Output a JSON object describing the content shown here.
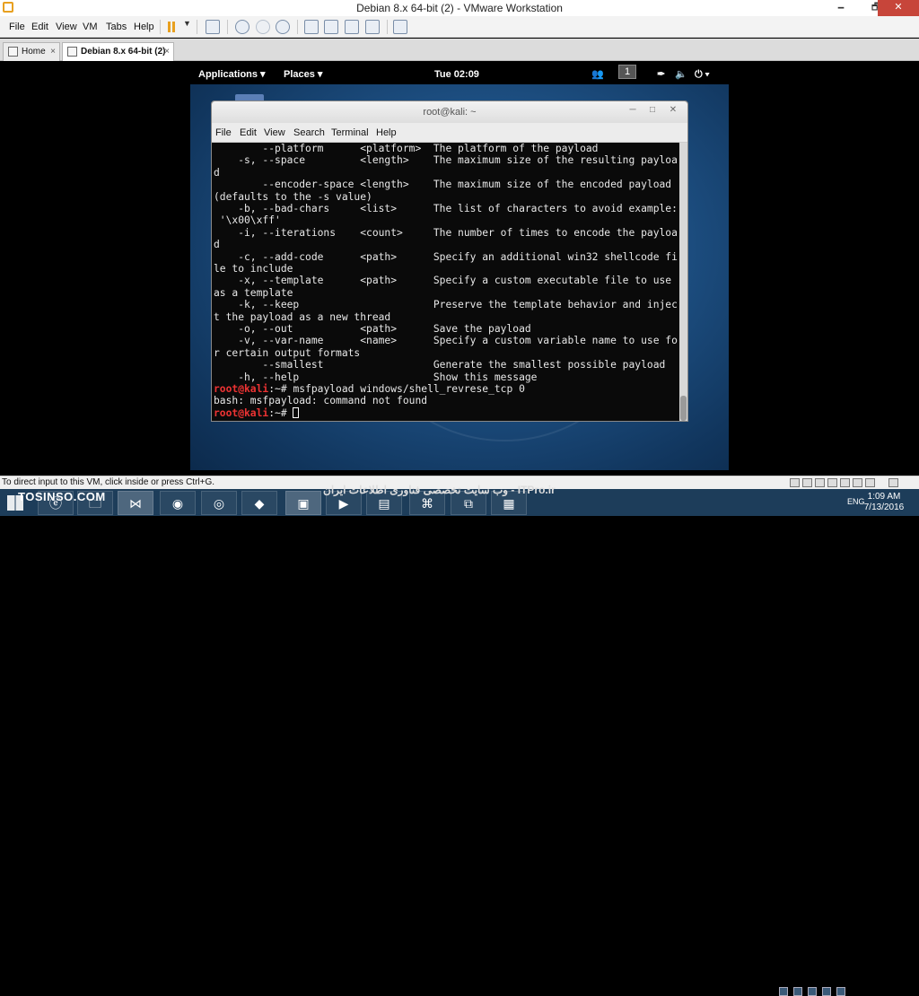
{
  "window": {
    "title": "Debian 8.x 64-bit (2) - VMware Workstation",
    "minimize": "🗕",
    "maximize": "🗗",
    "close": "✕"
  },
  "menu": [
    "File",
    "Edit",
    "View",
    "VM",
    "Tabs",
    "Help"
  ],
  "tabs": [
    {
      "label": "Home",
      "close": "×"
    },
    {
      "label": "Debian 8.x 64-bit (2)",
      "close": "×"
    }
  ],
  "gnome": {
    "applications": "Applications ▾",
    "places": "Places ▾",
    "clock": "Tue 02:09",
    "workspace": "1",
    "power": "⏻ ▾"
  },
  "terminal": {
    "title": "root@kali: ~",
    "menu": [
      "File",
      "Edit",
      "View",
      "Search",
      "Terminal",
      "Help"
    ],
    "lines": [
      "        --platform      <platform>  The platform of the payload",
      "    -s, --space         <length>    The maximum size of the resulting payloa",
      "d",
      "        --encoder-space <length>    The maximum size of the encoded payload",
      "(defaults to the -s value)",
      "    -b, --bad-chars     <list>      The list of characters to avoid example:",
      " '\\x00\\xff'",
      "    -i, --iterations    <count>     The number of times to encode the payloa",
      "d",
      "    -c, --add-code      <path>      Specify an additional win32 shellcode fi",
      "le to include",
      "    -x, --template      <path>      Specify a custom executable file to use",
      "as a template",
      "    -k, --keep                      Preserve the template behavior and injec",
      "t the payload as a new thread",
      "    -o, --out           <path>      Save the payload",
      "    -v, --var-name      <name>      Specify a custom variable name to use fo",
      "r certain output formats",
      "        --smallest                  Generate the smallest possible payload",
      "    -h, --help                      Show this message"
    ],
    "prompt_user": "root@kali",
    "prompt_path": ":~# ",
    "command": "msfpayload windows/shell_revrese_tcp 0",
    "error": "bash: msfpayload: command not found"
  },
  "status_bar": "To direct input to this VM, click inside or press Ctrl+G.",
  "taskbar": {
    "watermark_left": "TOSINSO.COM",
    "watermark_right": "وب سایت تخصصی فناوری اطلاعات ایران - ITPro.ir",
    "time": "1:09 AM",
    "date": "7/13/2016",
    "lang": "ENG"
  }
}
